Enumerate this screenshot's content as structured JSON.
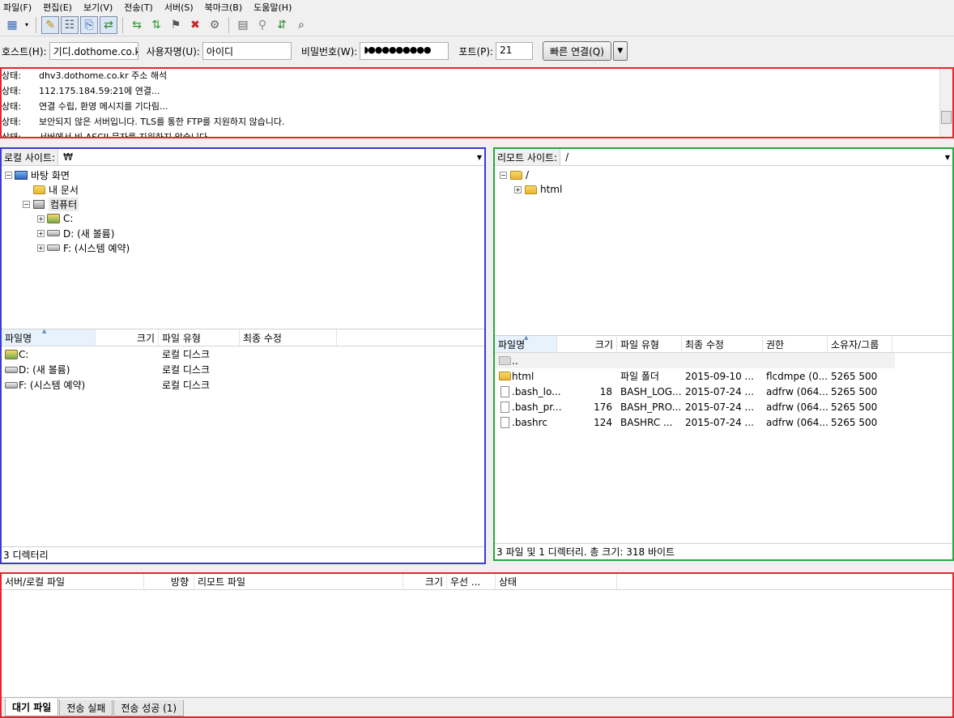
{
  "menu": [
    "파일(F)",
    "편집(E)",
    "보기(V)",
    "전송(T)",
    "서버(S)",
    "북마크(B)",
    "도움말(H)"
  ],
  "quickconnect": {
    "host_label": "호스트(H):",
    "host_value": "기디.dothome.co.kr",
    "user_label": "사용자명(U):",
    "user_value": "아이디",
    "pass_label": "비밀번호(W):",
    "pass_value": "◗●●●●●●●●●",
    "port_label": "포트(P):",
    "port_value": "21",
    "connect_label": "빠른 연결(Q)"
  },
  "log": [
    {
      "key": "상태:",
      "msg": "dhv3.dothome.co.kr 주소 해석"
    },
    {
      "key": "상태:",
      "msg": "112.175.184.59:21에 연결..."
    },
    {
      "key": "상태:",
      "msg": "연결 수립, 환영 메시지를 기다림..."
    },
    {
      "key": "상태:",
      "msg": "보안되지 않은 서버입니다. TLS를 통한 FTP를 지원하지 않습니다."
    },
    {
      "key": "상태:",
      "msg": "서버에서 비 ASCII 문자를 지원하지 않습니다."
    }
  ],
  "local": {
    "site_label": "로컬 사이트:",
    "site_value": "₩",
    "tree": [
      "바탕 화면",
      "내 문서",
      "컴퓨터",
      "C:",
      "D: (새 볼륨)",
      "F: (시스템 예약)"
    ],
    "columns": [
      "파일명",
      "크기",
      "파일 유형",
      "최종 수정"
    ],
    "rows": [
      {
        "name": "C:",
        "type": "로컬 디스크"
      },
      {
        "name": "D: (새 볼륨)",
        "type": "로컬 디스크"
      },
      {
        "name": "F: (시스템 예약)",
        "type": "로컬 디스크"
      }
    ],
    "status": "3 디렉터리"
  },
  "remote": {
    "site_label": "리모트 사이트:",
    "site_value": "/",
    "tree": [
      "/",
      "html"
    ],
    "columns": [
      "파일명",
      "크기",
      "파일 유형",
      "최종 수정",
      "권한",
      "소유자/그룹"
    ],
    "rows": [
      {
        "name": "..",
        "size": "",
        "type": "",
        "modified": "",
        "perm": "",
        "owner": ""
      },
      {
        "name": "html",
        "size": "",
        "type": "파일 폴더",
        "modified": "2015-09-10 ...",
        "perm": "flcdmpe (0...",
        "owner": "5265 500"
      },
      {
        "name": ".bash_lo...",
        "size": "18",
        "type": "BASH_LOG...",
        "modified": "2015-07-24 ...",
        "perm": "adfrw (064...",
        "owner": "5265 500"
      },
      {
        "name": ".bash_pr...",
        "size": "176",
        "type": "BASH_PRO...",
        "modified": "2015-07-24 ...",
        "perm": "adfrw (064...",
        "owner": "5265 500"
      },
      {
        "name": ".bashrc",
        "size": "124",
        "type": "BASHRC ...",
        "modified": "2015-07-24 ...",
        "perm": "adfrw (064...",
        "owner": "5265 500"
      }
    ],
    "status": "3 파일 및 1 디렉터리. 총 크기: 318 바이트"
  },
  "queue": {
    "columns": [
      "서버/로컬 파일",
      "방향",
      "리모트 파일",
      "크기",
      "우선 ...",
      "상태"
    ],
    "tabs": [
      "대기 파일",
      "전송 실패",
      "전송 성공 (1)"
    ]
  },
  "colors": {
    "highlight_red": "#e8242d",
    "highlight_blue": "#3a3ad6",
    "highlight_green": "#26a83a"
  }
}
